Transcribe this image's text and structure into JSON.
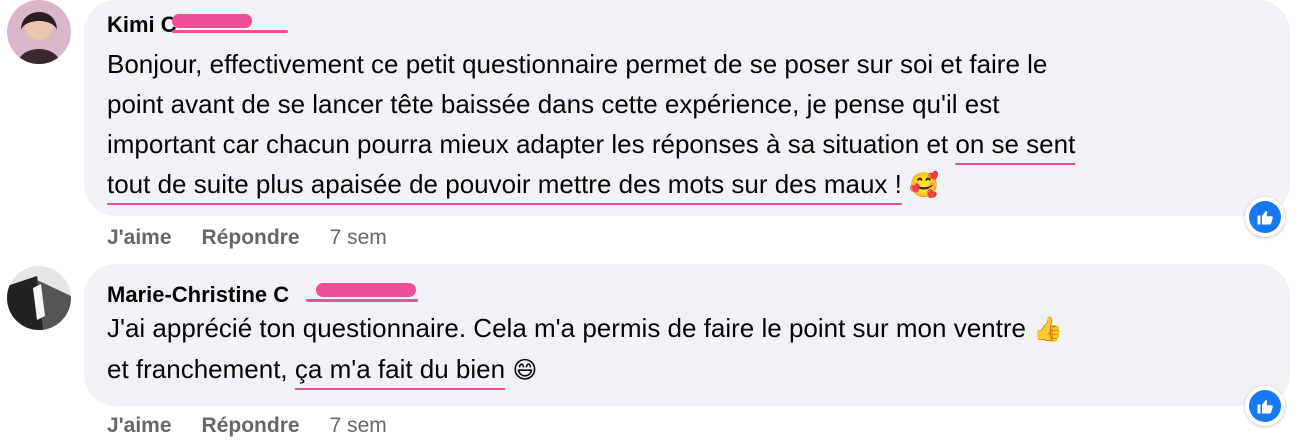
{
  "comments": [
    {
      "author": "Kimi C",
      "text_lines": [
        "Bonjour, effectivement ce petit questionnaire permet de se poser sur soi et faire le",
        "point avant de se lancer tête baissée dans cette expérience, je pense qu'il est",
        "important car chacun pourra mieux adapter les réponses à sa situation et "
      ],
      "text_underlined_1": "on se sent",
      "text_underlined_2": "tout de suite plus apaisée de pouvoir mettre des mots sur des maux !",
      "emoji": "🥰",
      "like_label": "J'aime",
      "reply_label": "Répondre",
      "time": "7 sem",
      "reaction_icon": "like-icon"
    },
    {
      "author": "Marie-Christine C",
      "text_line_1": "J'ai apprécié ton questionnaire. Cela m'a permis de faire le point sur mon ventre ",
      "emoji_1": "👍",
      "text_line_2": "et franchement, ",
      "text_underlined": "ça m'a fait du bien",
      "emoji_2": "😄",
      "like_label": "J'aime",
      "reply_label": "Répondre",
      "time": "7 sem",
      "reaction_icon": "like-icon"
    }
  ],
  "colors": {
    "bubble_bg": "#f0f2f5",
    "redaction": "#ec4f95",
    "accent_blue": "#1877f2",
    "meta_text": "#65676b"
  }
}
